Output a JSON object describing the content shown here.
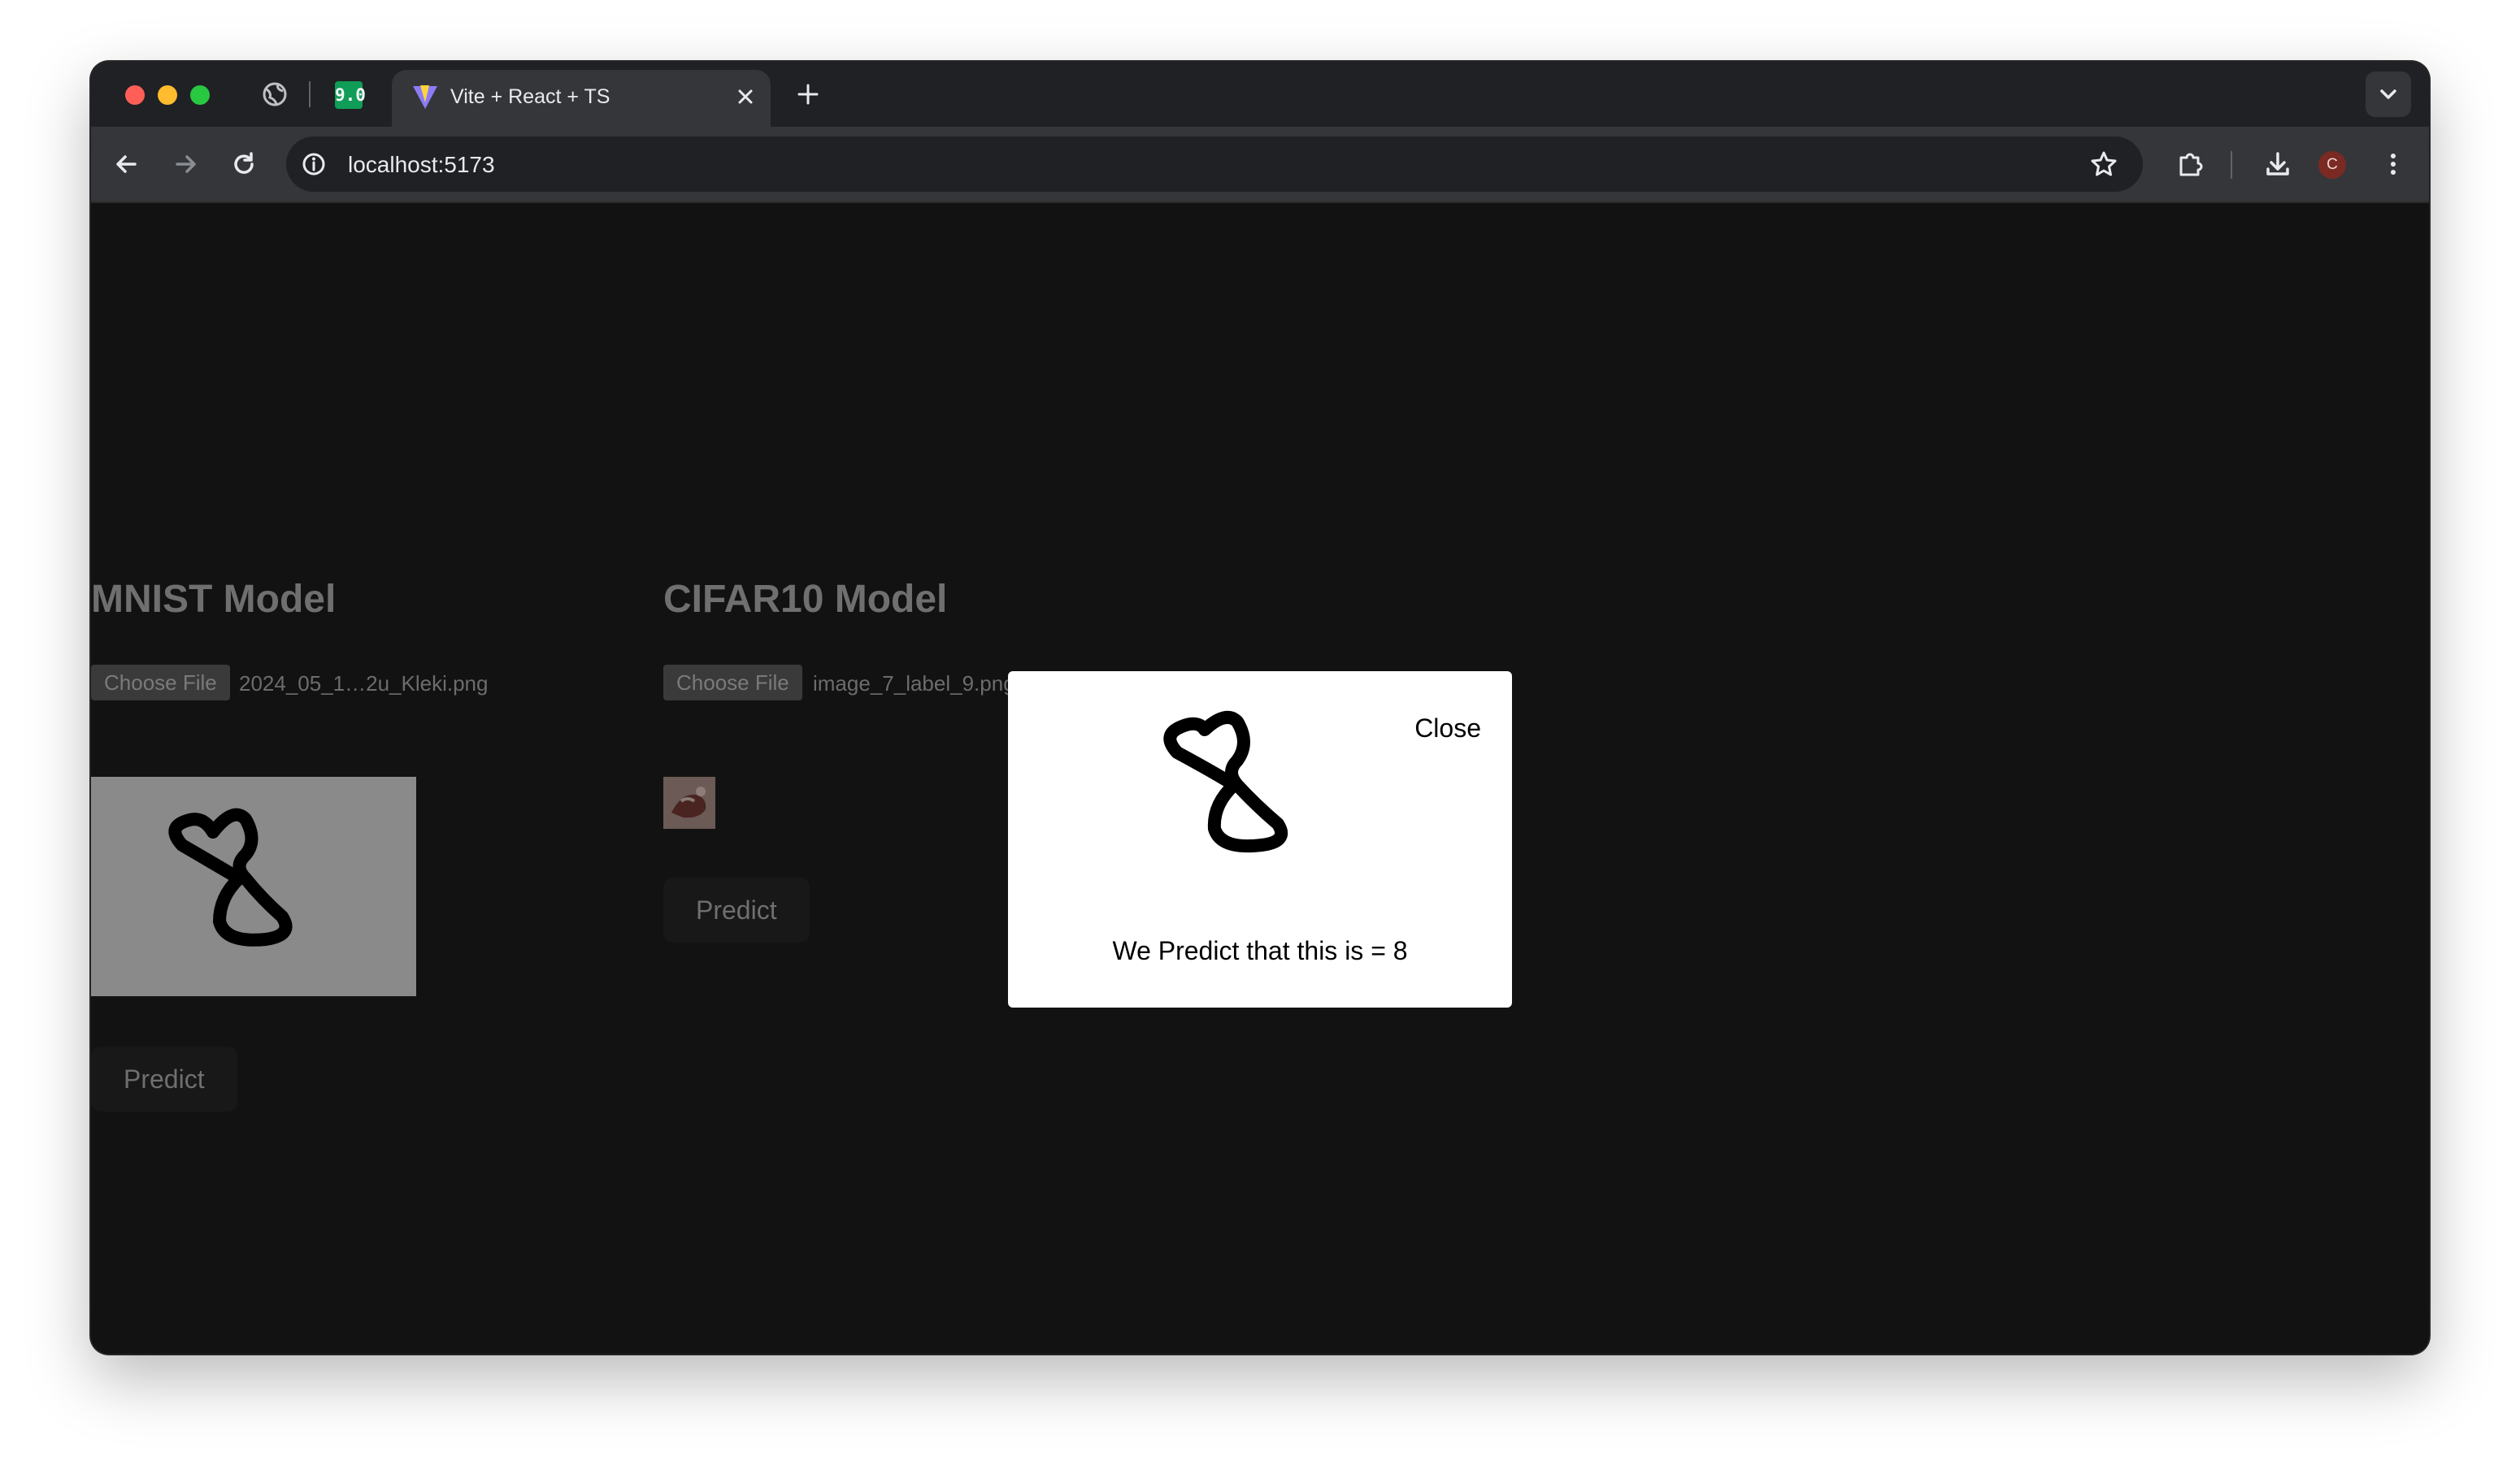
{
  "browser": {
    "tab_title": "Vite + React + TS",
    "pinned_tab_badge": "9.0",
    "url": "localhost:5173",
    "profile_initial": "C",
    "icons": [
      "globe-icon",
      "grafana-icon",
      "vite-icon",
      "close-icon",
      "plus-icon",
      "chevron-down-icon",
      "back-icon",
      "forward-icon",
      "reload-icon",
      "info-icon",
      "star-icon",
      "extensions-icon",
      "download-icon",
      "more-icon"
    ]
  },
  "mnist": {
    "title": "MNIST Model",
    "choose_file_label": "Choose File",
    "file_name": "2024_05_1…2u_Kleki.png",
    "predict_label": "Predict"
  },
  "cifar": {
    "title": "CIFAR10 Model",
    "choose_file_label": "Choose File",
    "file_name": "image_7_label_9.png",
    "predict_label": "Predict"
  },
  "modal": {
    "close_label": "Close",
    "prediction_text": "We Predict that this is = 8"
  },
  "colors": {
    "page_background": "#121212",
    "modal_background": "#ffffff",
    "mnist_preview_background": "#8a8a8a"
  }
}
